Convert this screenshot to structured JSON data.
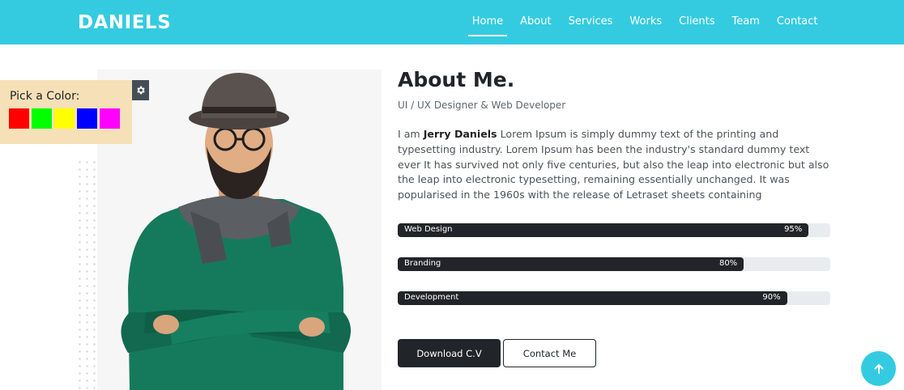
{
  "header": {
    "brand": "DANIELS",
    "nav": [
      "Home",
      "About",
      "Services",
      "Works",
      "Clients",
      "Team",
      "Contact"
    ],
    "active_index": 0,
    "color": "#34cbe0"
  },
  "picker": {
    "title": "Pick a Color:",
    "swatches": [
      "#ff0000",
      "#00ff00",
      "#ffff00",
      "#0000ff",
      "#ff00ff"
    ],
    "gear_icon": "gear-icon"
  },
  "about": {
    "title": "About Me.",
    "subtitle": "UI / UX Designer & Web Developer",
    "bio_prefix": "I am ",
    "bio_name": "Jerry Daniels",
    "bio_text": " Lorem Ipsum is simply dummy text of the printing and typesetting industry. Lorem Ipsum has been the industry's standard dummy text ever It has survived not only five centuries, but also the leap into electronic but also the leap into electronic typesetting, remaining essentially unchanged. It was popularised in the 1960s with the release of Letraset sheets containing"
  },
  "skills": [
    {
      "label": "Web Design",
      "percent_text": "95%",
      "value": 95
    },
    {
      "label": "Branding",
      "percent_text": "80%",
      "value": 80
    },
    {
      "label": "Development",
      "percent_text": "90%",
      "value": 90
    }
  ],
  "buttons": {
    "download": "Download C.V",
    "contact": "Contact Me"
  },
  "scroll_top_icon": "arrow-up-icon"
}
